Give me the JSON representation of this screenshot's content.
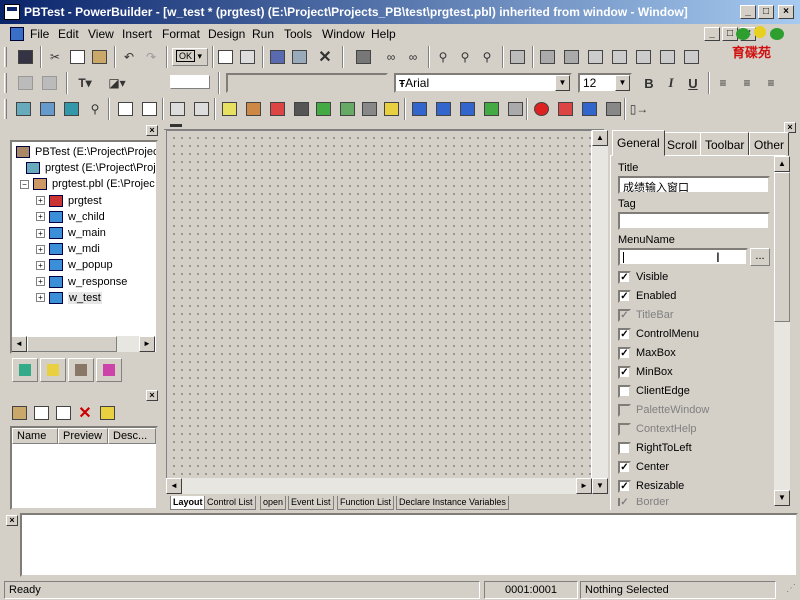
{
  "window": {
    "title": "PBTest - PowerBuilder - [w_test * (prgtest) (E:\\Project\\Projects_PB\\test\\prgtest.pbl) inherited from window - Window]"
  },
  "caption_buttons": [
    "_",
    "□",
    "×"
  ],
  "mdi_buttons": [
    "_",
    "□",
    "×"
  ],
  "logo_text": "育碟苑",
  "menu": {
    "file": "File",
    "edit": "Edit",
    "view": "View",
    "insert": "Insert",
    "format": "Format",
    "design": "Design",
    "run": "Run",
    "tools": "Tools",
    "window": "Window",
    "help": "Help"
  },
  "toolbar": {
    "font_name": "Arial",
    "font_size": "12",
    "bold": "B",
    "italic": "I",
    "underline": "U",
    "ok_label": "OK"
  },
  "tree": {
    "items": [
      {
        "label": "PBTest (E:\\Project\\Projects_",
        "icon": "workspace-icon"
      },
      {
        "label": "prgtest (E:\\Project\\Proje",
        "icon": "target-icon"
      },
      {
        "label": "prgtest.pbl (E:\\Projec",
        "icon": "library-icon"
      },
      {
        "label": "prgtest",
        "icon": "application-icon"
      },
      {
        "label": "w_child",
        "icon": "window-icon"
      },
      {
        "label": "w_main",
        "icon": "window-icon"
      },
      {
        "label": "w_mdi",
        "icon": "window-icon"
      },
      {
        "label": "w_popup",
        "icon": "window-icon"
      },
      {
        "label": "w_response",
        "icon": "window-icon"
      },
      {
        "label": "w_test",
        "icon": "window-icon"
      }
    ]
  },
  "list_view": {
    "columns": [
      "Name",
      "Preview",
      "Desc..."
    ]
  },
  "properties": {
    "tabs": [
      "General",
      "Scroll",
      "Toolbar",
      "Other"
    ],
    "title_label": "Title",
    "title_value": "成绩输入窗口",
    "tag_label": "Tag",
    "tag_value": "",
    "menuname_label": "MenuName",
    "menuname_value": "",
    "browse_label": "...",
    "checkboxes": [
      {
        "label": "Visible",
        "checked": true,
        "enabled": true
      },
      {
        "label": "Enabled",
        "checked": true,
        "enabled": true
      },
      {
        "label": "TitleBar",
        "checked": true,
        "enabled": false
      },
      {
        "label": "ControlMenu",
        "checked": true,
        "enabled": true
      },
      {
        "label": "MaxBox",
        "checked": true,
        "enabled": true
      },
      {
        "label": "MinBox",
        "checked": true,
        "enabled": true
      },
      {
        "label": "ClientEdge",
        "checked": false,
        "enabled": true
      },
      {
        "label": "PaletteWindow",
        "checked": false,
        "enabled": false
      },
      {
        "label": "ContextHelp",
        "checked": false,
        "enabled": false
      },
      {
        "label": "RightToLeft",
        "checked": false,
        "enabled": true
      },
      {
        "label": "Center",
        "checked": true,
        "enabled": true
      },
      {
        "label": "Resizable",
        "checked": true,
        "enabled": true
      },
      {
        "label": "Border",
        "checked": true,
        "enabled": false
      }
    ]
  },
  "bottom_tabs": [
    "Layout",
    "Control List",
    "open",
    "Event List",
    "Function List",
    "Declare Instance Variables"
  ],
  "statusbar": {
    "left": "Ready",
    "position": "0001:0001",
    "selection": "Nothing Selected"
  }
}
